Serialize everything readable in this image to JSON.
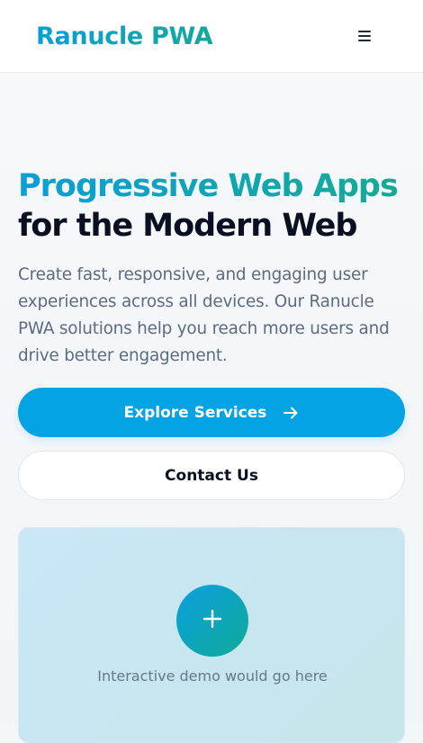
{
  "header": {
    "brand": "Ranucle PWA",
    "menu_icon": "hamburger-menu-icon"
  },
  "hero": {
    "title_line1": "Progressive Web Apps",
    "title_line2": "for the Modern Web",
    "description": "Create fast, responsive, and engaging user experiences across all devices. Our Ranucle PWA solutions help you reach more users and drive better engagement."
  },
  "actions": {
    "primary_label": "Explore Services",
    "primary_icon": "arrow-right-icon",
    "secondary_label": "Contact Us"
  },
  "demo": {
    "icon": "plus-icon",
    "caption": "Interactive demo would go here"
  },
  "colors": {
    "brand_blue": "#04a3e4",
    "brand_teal": "#12a99b",
    "heading_dark": "#0b1020",
    "body_text": "#5d6b7f"
  }
}
